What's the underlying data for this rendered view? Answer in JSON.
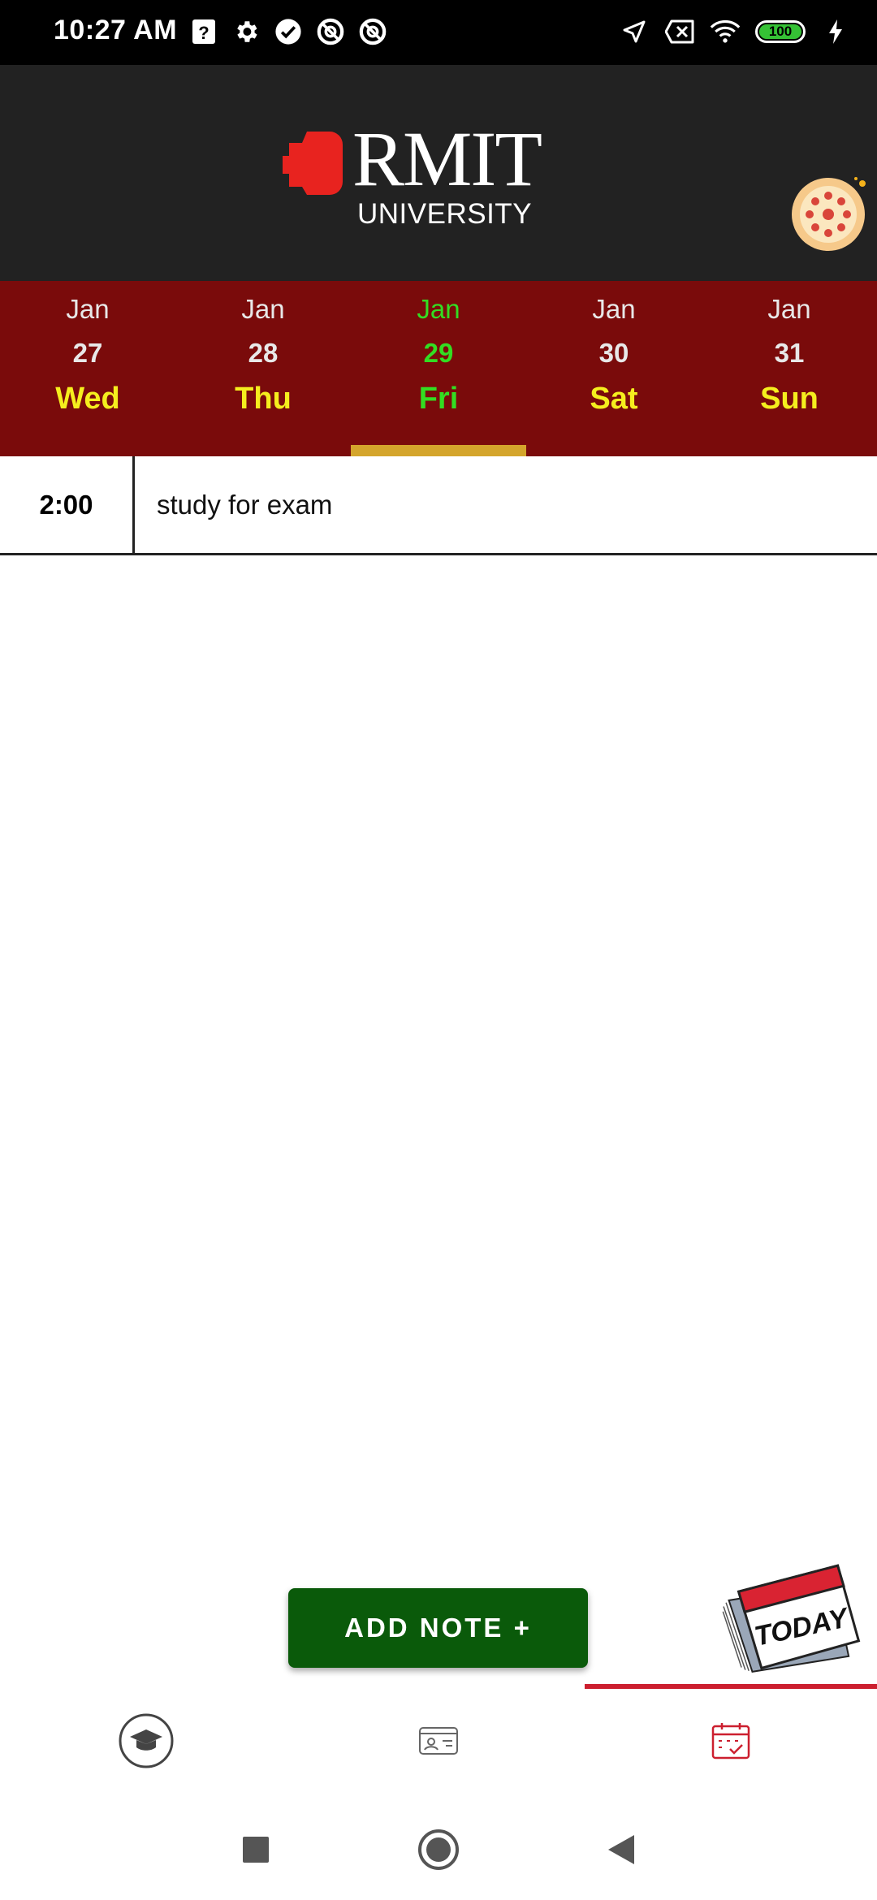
{
  "status_bar": {
    "time": "10:27 AM",
    "battery_level": "100",
    "left_icons": [
      "help-box-icon",
      "gear-icon",
      "check-circle-icon",
      "blocked-circle-icon",
      "blocked-circle-icon"
    ],
    "right_icons": [
      "location-arrow-icon",
      "sim-off-icon",
      "wifi-icon",
      "battery-icon",
      "charging-bolt-icon"
    ]
  },
  "header": {
    "logo_word": "RMIT",
    "logo_sub": "UNIVERSITY",
    "profile_icon": "pizza-icon"
  },
  "date_strip": {
    "days": [
      {
        "month": "Jan",
        "num": "27",
        "day": "Wed",
        "active": false
      },
      {
        "month": "Jan",
        "num": "28",
        "day": "Thu",
        "active": false
      },
      {
        "month": "Jan",
        "num": "29",
        "day": "Fri",
        "active": true
      },
      {
        "month": "Jan",
        "num": "30",
        "day": "Sat",
        "active": false
      },
      {
        "month": "Jan",
        "num": "31",
        "day": "Sun",
        "active": false
      }
    ]
  },
  "notes": [
    {
      "time": "2:00",
      "text": "study for exam"
    }
  ],
  "actions": {
    "add_note_label": "ADD NOTE +"
  },
  "today_art": {
    "label": "TODAY"
  },
  "bottom_nav": {
    "items": [
      {
        "icon": "graduation-cap-icon"
      },
      {
        "icon": "id-card-icon"
      },
      {
        "icon": "calendar-check-icon",
        "selected": true
      }
    ]
  },
  "colors": {
    "header_bg": "#222222",
    "date_strip_bg": "#7a0b0b",
    "active_day": "#33dd22",
    "day_name": "#f5ee1e",
    "indicator": "#d4a52c",
    "add_button": "#0a5a0a",
    "nav_selected": "#cc1f2f"
  }
}
